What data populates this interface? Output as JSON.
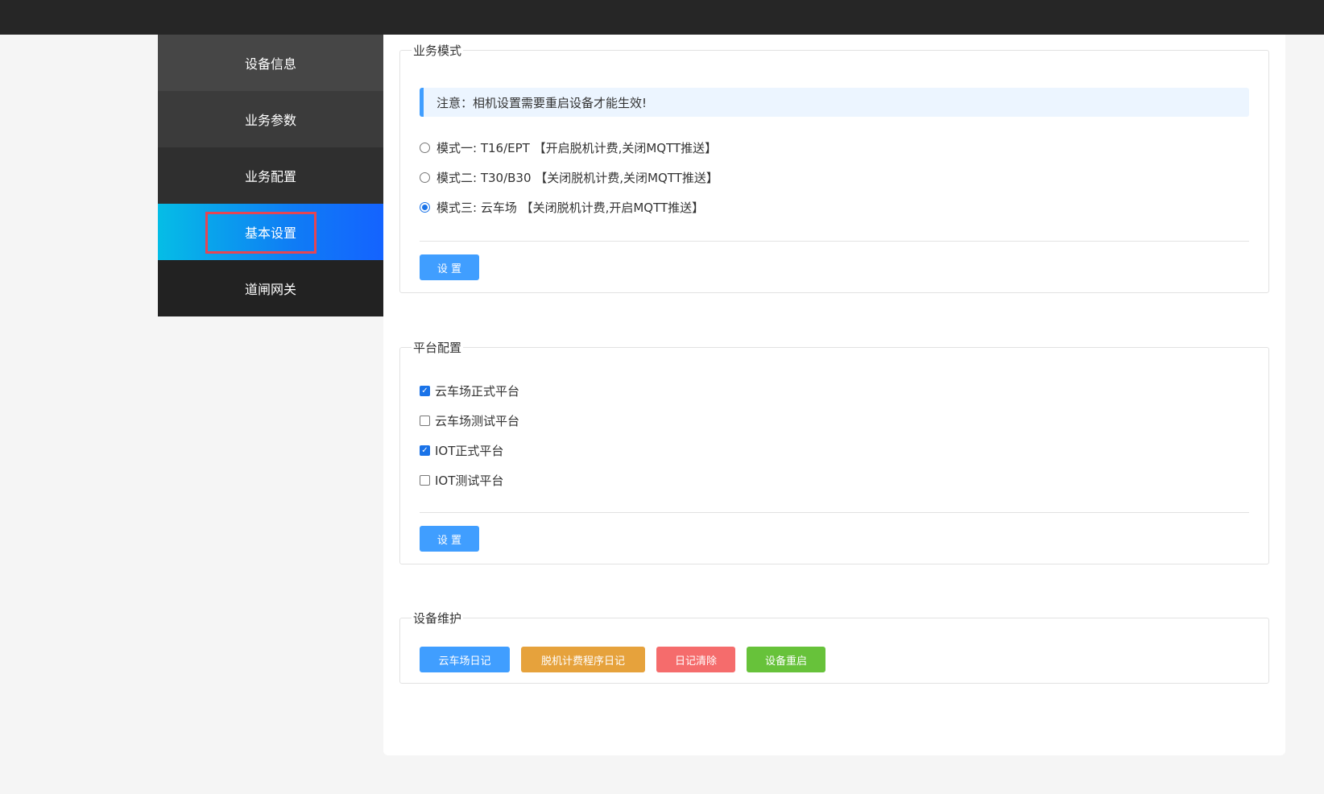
{
  "sidebar": {
    "items": [
      {
        "label": "设备信息"
      },
      {
        "label": "业务参数"
      },
      {
        "label": "业务配置"
      },
      {
        "label": "基本设置"
      },
      {
        "label": "道闸网关"
      }
    ],
    "active_index": 3
  },
  "business_mode": {
    "legend": "业务模式",
    "notice": "注意：相机设置需要重启设备才能生效!",
    "options": [
      {
        "label": "模式一: T16/EPT 【开启脱机计费,关闭MQTT推送】",
        "checked": false
      },
      {
        "label": "模式二: T30/B30 【关闭脱机计费,关闭MQTT推送】",
        "checked": false
      },
      {
        "label": "模式三: 云车场 【关闭脱机计费,开启MQTT推送】",
        "checked": true
      }
    ],
    "submit_label": "设 置"
  },
  "platform_config": {
    "legend": "平台配置",
    "options": [
      {
        "label": "云车场正式平台",
        "checked": true
      },
      {
        "label": "云车场测试平台",
        "checked": false
      },
      {
        "label": "IOT正式平台",
        "checked": true
      },
      {
        "label": "IOT测试平台",
        "checked": false
      }
    ],
    "submit_label": "设 置"
  },
  "device_maintenance": {
    "legend": "设备维护",
    "buttons": [
      {
        "label": "云车场日记",
        "color": "#409eff"
      },
      {
        "label": "脱机计费程序日记",
        "color": "#e6a23c"
      },
      {
        "label": "日记清除",
        "color": "#f56c6c"
      },
      {
        "label": "设备重启",
        "color": "#67c23a"
      }
    ]
  },
  "colors": {
    "primary": "#409eff",
    "highlight_border": "#e64553"
  }
}
